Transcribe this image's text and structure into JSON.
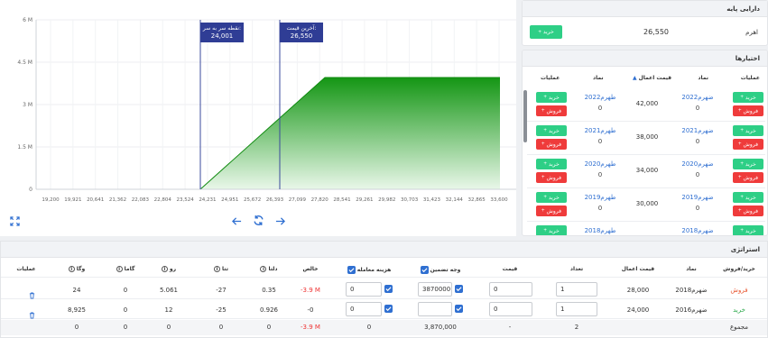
{
  "chart": {
    "y_ticks": [
      "6 M",
      "4.5 M",
      "3 M",
      "1.5 M",
      "0"
    ],
    "x_ticks": [
      "19,200",
      "19,921",
      "20,641",
      "21,362",
      "22,083",
      "22,804",
      "23,524",
      "24,231",
      "24,951",
      "25,672",
      "26,393",
      "27,099",
      "27,820",
      "28,541",
      "29,261",
      "29,982",
      "30,703",
      "31,423",
      "32,144",
      "32,865",
      "33,600"
    ],
    "breakeven_label": "نقطه سر به سر:",
    "breakeven_value": "24,001",
    "last_price_label": "آخرین قیمت:",
    "last_price_value": "26,550",
    "colors": {
      "fill": "#1a9c1a",
      "line": "#3a4a9c",
      "tag": "#2f3d95"
    }
  },
  "base_asset": {
    "title": "دارایی پایه",
    "symbol": "اهرم",
    "price": "26,550",
    "buy_label": "خرید"
  },
  "options": {
    "title": "اختیارها",
    "headers": {
      "actions_right": "عملیات",
      "symbol_right": "نماد",
      "strike": "قیمت اعمال",
      "symbol_left": "نماد",
      "actions_left": "عملیات"
    },
    "buy_label": "خرید",
    "sell_label": "فروش",
    "rows": [
      {
        "call_symbol": "ضهرم2022",
        "call_sub": "0",
        "strike": "42,000",
        "put_symbol": "طهرم2022",
        "put_sub": "0"
      },
      {
        "call_symbol": "ضهرم2021",
        "call_sub": "0",
        "strike": "38,000",
        "put_symbol": "طهرم2021",
        "put_sub": "0"
      },
      {
        "call_symbol": "ضهرم2020",
        "call_sub": "0",
        "strike": "34,000",
        "put_symbol": "طهرم2020",
        "put_sub": "0"
      },
      {
        "call_symbol": "ضهرم2019",
        "call_sub": "0",
        "strike": "30,000",
        "put_symbol": "طهرم2019",
        "put_sub": "0"
      },
      {
        "call_symbol": "ضهرم2018",
        "call_sub": "",
        "strike": "",
        "put_symbol": "طهرم2018",
        "put_sub": ""
      }
    ]
  },
  "strategy": {
    "title": "استراتژی",
    "headers": {
      "side": "خرید/فروش",
      "symbol": "نماد",
      "strike": "قیمت اعمال",
      "qty": "تعداد",
      "price": "قیمت",
      "margin": "وجه تضمین",
      "fee": "هزینه معامله",
      "net": "خالص",
      "delta": "دلتا",
      "theta": "تتا",
      "rho": "رو",
      "gamma": "گاما",
      "vega": "وگا",
      "actions": "عملیات"
    },
    "rows": [
      {
        "side": "فروش",
        "side_color": "#e8542e",
        "symbol": "ضهرم2018",
        "strike": "28,000",
        "qty": "1",
        "price": "0",
        "margin": "3870000",
        "fee": "0",
        "net": "-3.9 M",
        "delta": "0.35",
        "theta": "-27",
        "rho": "5.061",
        "gamma": "0",
        "vega": "24"
      },
      {
        "side": "خرید",
        "side_color": "#2aa84a",
        "symbol": "ضهرم2016",
        "strike": "24,000",
        "qty": "1",
        "price": "0",
        "margin": "",
        "fee": "0",
        "net": "-0",
        "delta": "0.926",
        "theta": "-25",
        "rho": "12",
        "gamma": "0",
        "vega": "8,925"
      }
    ],
    "total": {
      "label": "مجموع",
      "qty": "2",
      "price": "-",
      "margin": "3,870,000",
      "fee": "0",
      "net": "-3.9 M",
      "delta": "0",
      "theta": "0",
      "rho": "0",
      "gamma": "0",
      "vega": "0"
    }
  }
}
